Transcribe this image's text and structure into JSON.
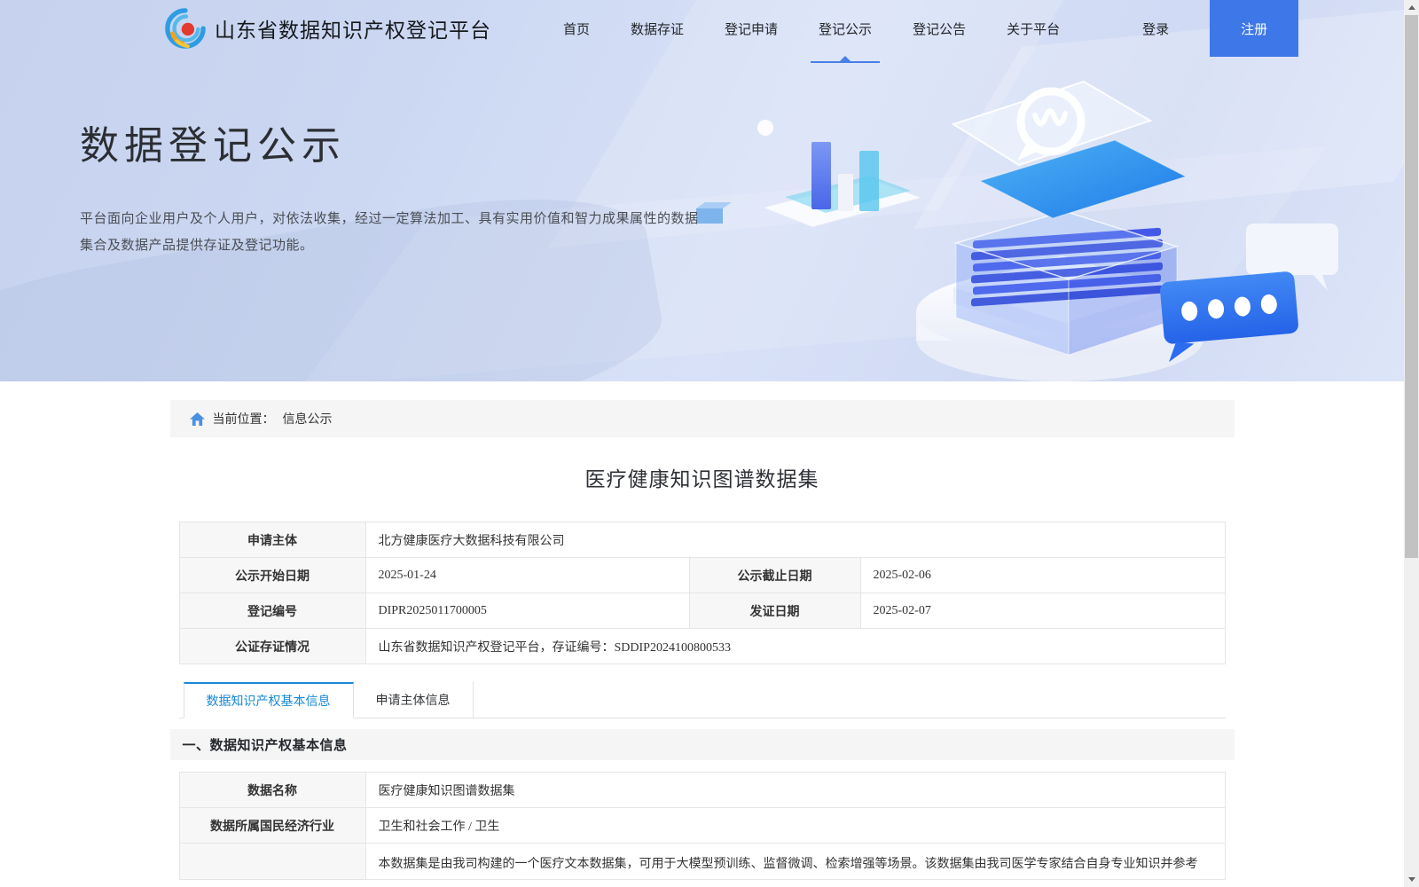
{
  "brand": {
    "title": "山东省数据知识产权登记平台"
  },
  "nav": {
    "items": [
      {
        "label": "首页",
        "active": false
      },
      {
        "label": "数据存证",
        "active": false
      },
      {
        "label": "登记申请",
        "active": false
      },
      {
        "label": "登记公示",
        "active": true
      },
      {
        "label": "登记公告",
        "active": false
      },
      {
        "label": "关于平台",
        "active": false
      }
    ],
    "login_label": "登录",
    "register_label": "注册"
  },
  "hero": {
    "title": "数据登记公示",
    "description": "平台面向企业用户及个人用户，对依法收集，经过一定算法加工、具有实用价值和智力成果属性的数据集合及数据产品提供存证及登记功能。"
  },
  "breadcrumb": {
    "prefix": "当前位置：",
    "current": "信息公示"
  },
  "detail": {
    "title": "医疗健康知识图谱数据集",
    "summary": {
      "applicant_label": "申请主体",
      "applicant": "北方健康医疗大数据科技有限公司",
      "publicity_start_label": "公示开始日期",
      "publicity_start": "2025-01-24",
      "publicity_end_label": "公示截止日期",
      "publicity_end": "2025-02-06",
      "registration_no_label": "登记编号",
      "registration_no": "DIPR2025011700005",
      "issue_date_label": "发证日期",
      "issue_date": "2025-02-07",
      "notary_label": "公证存证情况",
      "notary": "山东省数据知识产权登记平台，存证编号：SDDIP2024100800533"
    },
    "tabs": [
      {
        "label": "数据知识产权基本信息",
        "active": true
      },
      {
        "label": "申请主体信息",
        "active": false
      }
    ],
    "section_heading": "一、数据知识产权基本信息",
    "basic_info": {
      "name_label": "数据名称",
      "name": "医疗健康知识图谱数据集",
      "industry_label": "数据所属国民经济行业",
      "industry": "卫生和社会工作 / 卫生",
      "desc_label": "",
      "desc": "本数据集是由我司构建的一个医疗文本数据集，可用于大模型预训练、监督微调、检索增强等场景。该数据集由我司医学专家结合自身专业知识并参考"
    }
  },
  "colors": {
    "register_button_blue": "#3e78e8",
    "active_tab_blue": "#1789d6",
    "nav_underline_blue": "#4a7fe8",
    "breadcrumb_bg": "#f5f5f5",
    "logo_red": "#e23a2e",
    "logo_blue": "#2e9ce2",
    "logo_orange": "#f6a21c"
  }
}
